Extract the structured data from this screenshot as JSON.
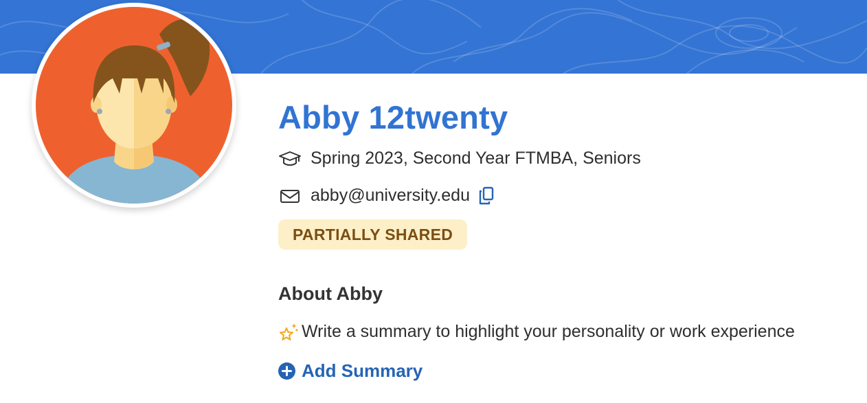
{
  "colors": {
    "banner": "#3474d4",
    "name": "#3174d2",
    "badge_bg": "#fdefc8",
    "badge_text": "#7b4e12",
    "link": "#2564b5",
    "avatar_bg": "#ee612e"
  },
  "profile": {
    "name": "Abby 12twenty",
    "class_info": "Spring 2023, Second Year FTMBA, Seniors",
    "class_icon": "graduation-cap-icon",
    "email": "abby@university.edu",
    "email_icon": "envelope-icon",
    "copy_icon": "copy-icon",
    "sharing_status": "PARTIALLY SHARED"
  },
  "about": {
    "title": "About Abby",
    "prompt_icon": "sparkle-star-icon",
    "prompt": "Write a summary to highlight your personality or work experience",
    "add_label": "Add Summary",
    "add_icon": "plus-circle-icon"
  }
}
